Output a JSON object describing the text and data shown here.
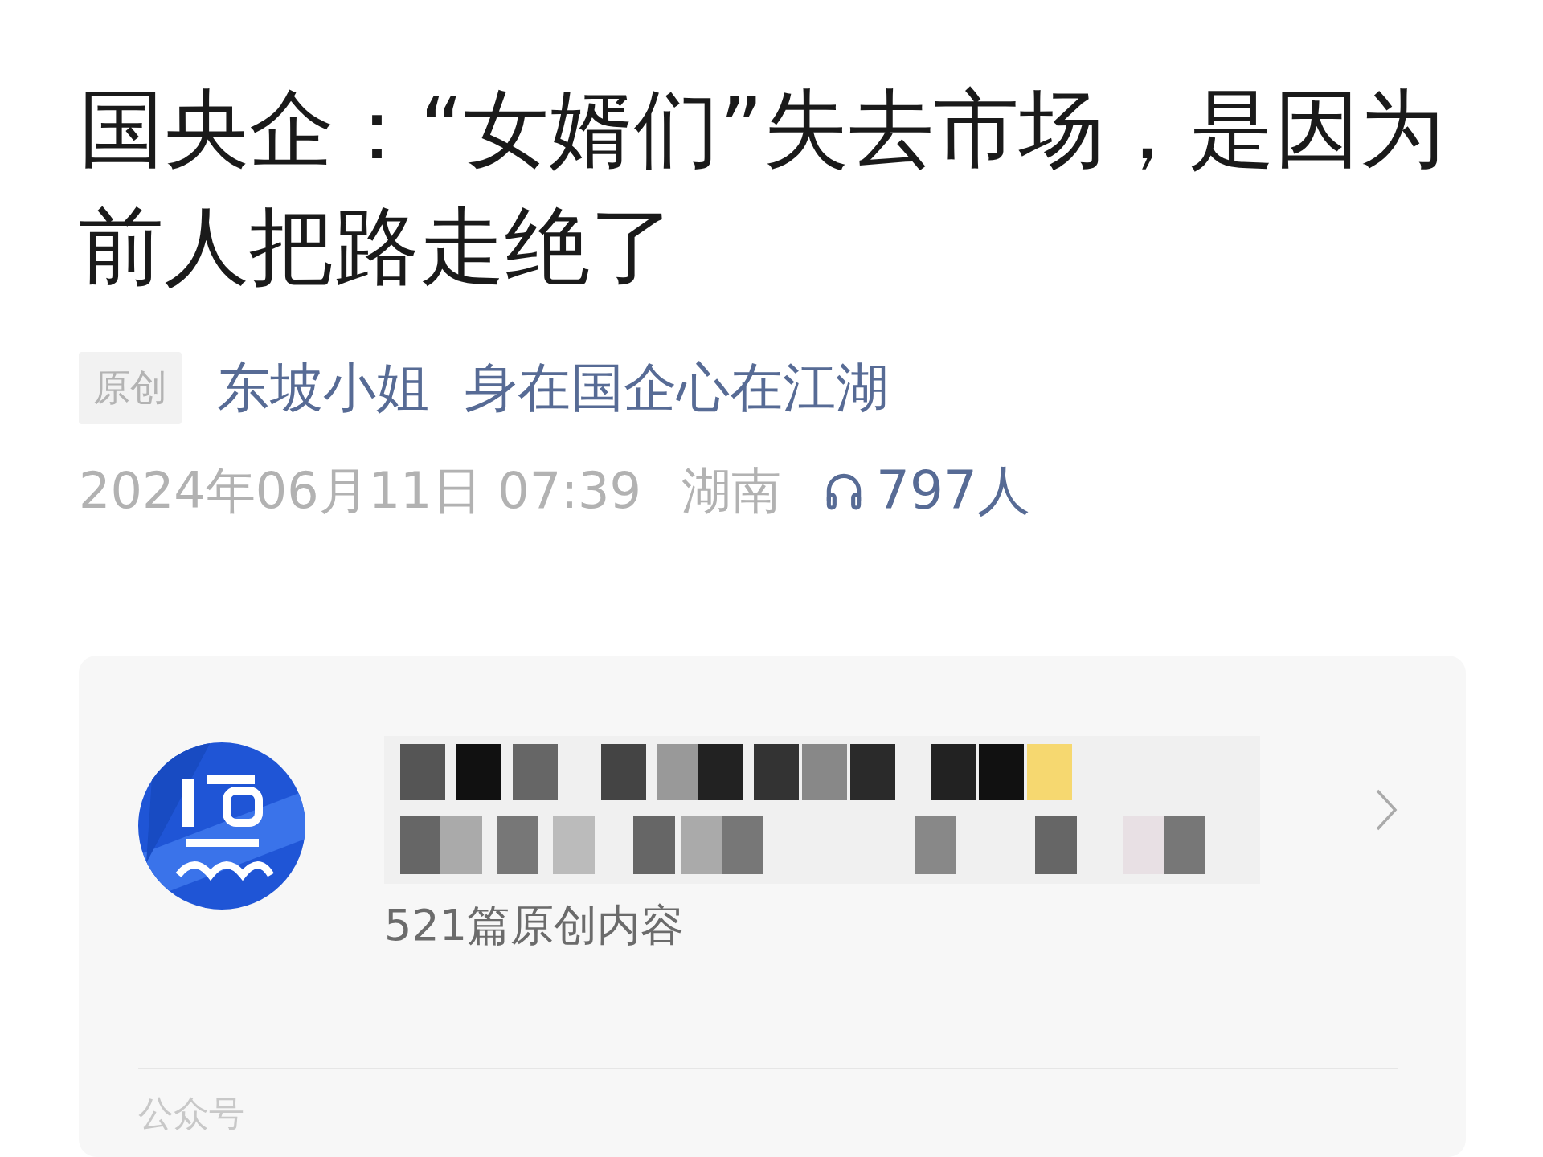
{
  "article": {
    "title": "国央企：“女婿们”失去市场，是因为前人把路走绝了",
    "badge": "原创",
    "author": "东坡小姐",
    "account": "身在国企心在江湖",
    "date": "2024年06月11日 07:39",
    "location": "湖南",
    "listeners": "797人"
  },
  "account_card": {
    "name_redacted": true,
    "stats": "521篇原创内容",
    "section_label": "公众号"
  }
}
